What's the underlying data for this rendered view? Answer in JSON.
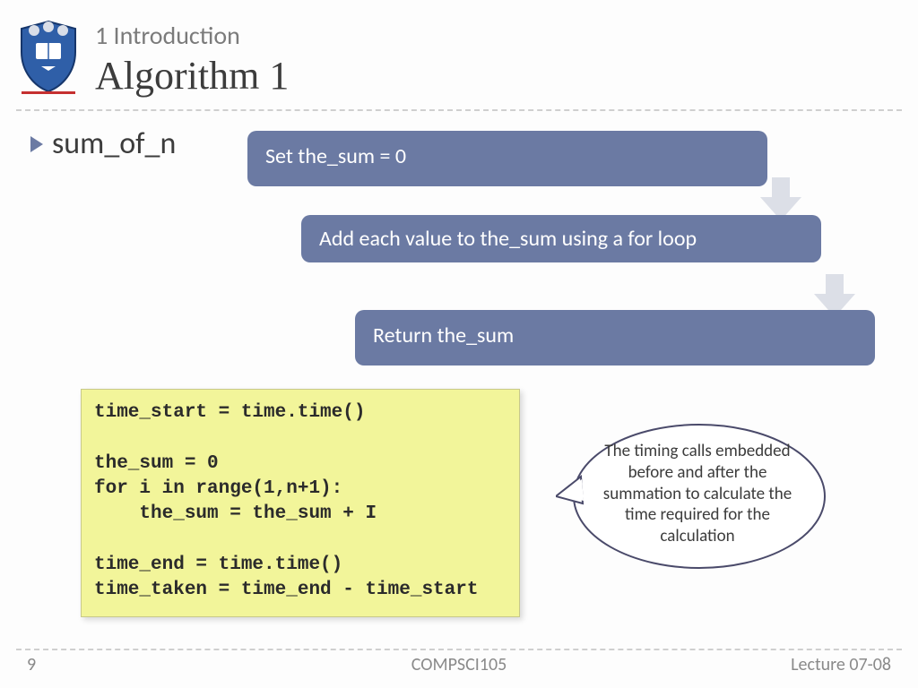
{
  "header": {
    "section": "1 Introduction",
    "title": "Algorithm 1"
  },
  "bullet": "sum_of_n",
  "steps": {
    "s1": "Set the_sum = 0",
    "s2": "Add each value to the_sum using a for loop",
    "s3": "Return the_sum"
  },
  "code": "time_start = time.time()\n\nthe_sum = 0\nfor i in range(1,n+1):\n    the_sum = the_sum + I\n\ntime_end = time.time()\ntime_taken = time_end - time_start",
  "callout": "The timing calls embedded before and after the summation to calculate the time required for the calculation",
  "footer": {
    "page": "9",
    "center": "COMPSCI105",
    "right": "Lecture 07-08"
  }
}
